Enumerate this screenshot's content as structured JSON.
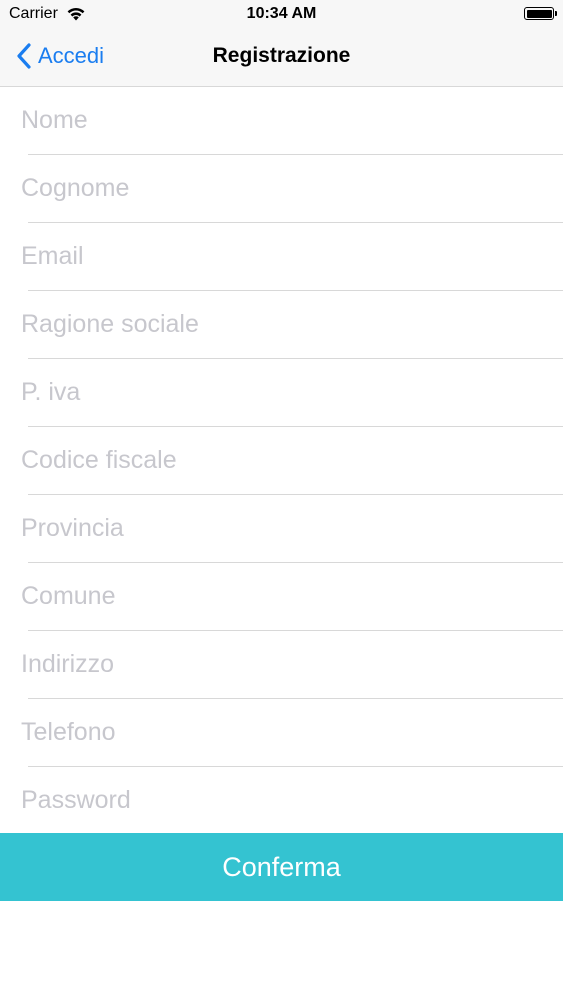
{
  "status_bar": {
    "carrier": "Carrier",
    "time": "10:34 AM",
    "battery_level": 1.0
  },
  "nav": {
    "back_label": "Accedi",
    "title": "Registrazione"
  },
  "form": {
    "fields": [
      {
        "placeholder": "Nome",
        "value": ""
      },
      {
        "placeholder": "Cognome",
        "value": ""
      },
      {
        "placeholder": "Email",
        "value": ""
      },
      {
        "placeholder": "Ragione sociale",
        "value": ""
      },
      {
        "placeholder": "P. iva",
        "value": ""
      },
      {
        "placeholder": "Codice fiscale",
        "value": ""
      },
      {
        "placeholder": "Provincia",
        "value": ""
      },
      {
        "placeholder": "Comune",
        "value": ""
      },
      {
        "placeholder": "Indirizzo",
        "value": ""
      },
      {
        "placeholder": "Telefono",
        "value": ""
      },
      {
        "placeholder": "Password",
        "value": ""
      }
    ],
    "confirm_label": "Conferma"
  },
  "colors": {
    "accent": "#1a7df0",
    "button": "#34c3d1",
    "placeholder": "#c7c7cd",
    "separator": "#d8d8d8",
    "bar_background": "#f7f7f7"
  }
}
